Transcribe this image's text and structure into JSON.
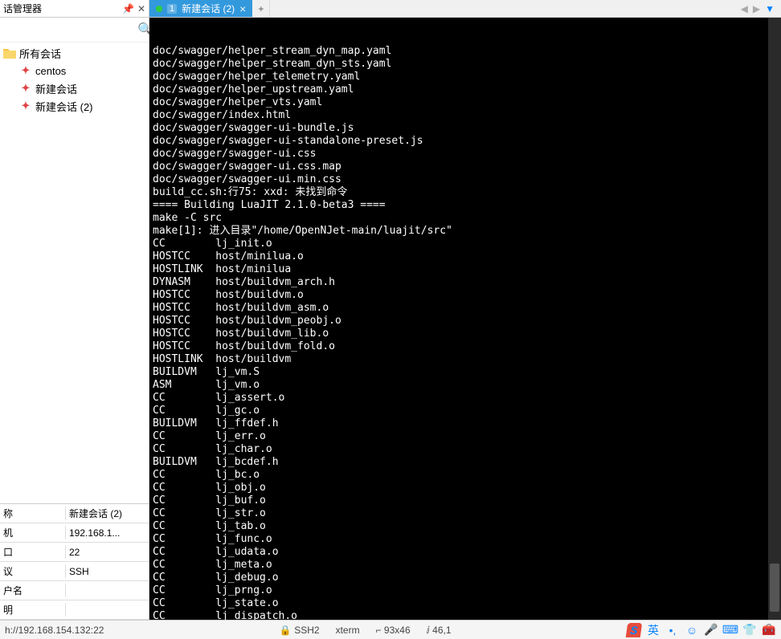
{
  "sidebar": {
    "title": "话管理器",
    "search_placeholder": "",
    "root": {
      "label": "所有会话"
    },
    "items": [
      {
        "label": "centos"
      },
      {
        "label": "新建会话"
      },
      {
        "label": "新建会话 (2)"
      }
    ]
  },
  "props": {
    "rows": [
      {
        "label": "称",
        "value": "新建会话 (2)"
      },
      {
        "label": "机",
        "value": "192.168.1..."
      },
      {
        "label": "口",
        "value": "22"
      },
      {
        "label": "议",
        "value": "SSH"
      },
      {
        "label": "户名",
        "value": ""
      },
      {
        "label": "明",
        "value": ""
      }
    ]
  },
  "tabs": {
    "active": {
      "num": "1",
      "title": "新建会话 (2)"
    }
  },
  "terminal": {
    "lines": [
      "doc/swagger/helper_stream_dyn_map.yaml",
      "doc/swagger/helper_stream_dyn_sts.yaml",
      "doc/swagger/helper_telemetry.yaml",
      "doc/swagger/helper_upstream.yaml",
      "doc/swagger/helper_vts.yaml",
      "doc/swagger/index.html",
      "doc/swagger/swagger-ui-bundle.js",
      "doc/swagger/swagger-ui-standalone-preset.js",
      "doc/swagger/swagger-ui.css",
      "doc/swagger/swagger-ui.css.map",
      "doc/swagger/swagger-ui.min.css",
      "build_cc.sh:行75: xxd: 未找到命令",
      "==== Building LuaJIT 2.1.0-beta3 ====",
      "make -C src",
      "make[1]: 进入目录\"/home/OpenNJet-main/luajit/src\"",
      "CC        lj_init.o",
      "HOSTCC    host/minilua.o",
      "HOSTLINK  host/minilua",
      "DYNASM    host/buildvm_arch.h",
      "HOSTCC    host/buildvm.o",
      "HOSTCC    host/buildvm_asm.o",
      "HOSTCC    host/buildvm_peobj.o",
      "HOSTCC    host/buildvm_lib.o",
      "HOSTCC    host/buildvm_fold.o",
      "HOSTLINK  host/buildvm",
      "BUILDVM   lj_vm.S",
      "ASM       lj_vm.o",
      "CC        lj_assert.o",
      "CC        lj_gc.o",
      "BUILDVM   lj_ffdef.h",
      "CC        lj_err.o",
      "CC        lj_char.o",
      "BUILDVM   lj_bcdef.h",
      "CC        lj_bc.o",
      "CC        lj_obj.o",
      "CC        lj_buf.o",
      "CC        lj_str.o",
      "CC        lj_tab.o",
      "CC        lj_func.o",
      "CC        lj_udata.o",
      "CC        lj_meta.o",
      "CC        lj_debug.o",
      "CC        lj_prng.o",
      "CC        lj_state.o",
      "CC        lj_dispatch.o"
    ]
  },
  "status": {
    "host": "h://192.168.154.132:22",
    "proto": "SSH2",
    "term": "xterm",
    "size": "⌐ 93x46",
    "pos": "ⅈ 46,1"
  },
  "ime": {
    "label": "英"
  }
}
